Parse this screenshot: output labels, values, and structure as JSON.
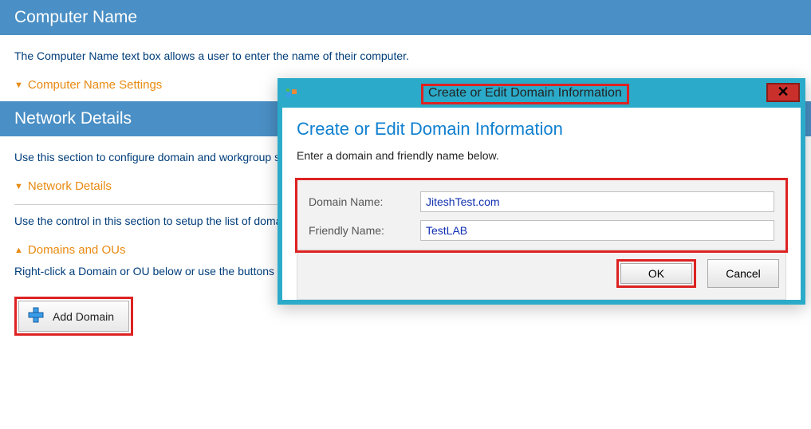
{
  "sections": {
    "computerName": {
      "title": "Computer Name",
      "description": "The Computer Name text box allows a user to enter the name of their computer.",
      "collapsible": "Computer Name Settings"
    },
    "networkDetails": {
      "title": "Network Details",
      "description": "Use this section to configure domain and workgroup settings.",
      "collapsible1": "Network Details",
      "midText": "Use the control in this section to setup the list of domains displayed to the user in the domain drop down list on this wizard page.",
      "collapsible2": "Domains and OUs",
      "belowText": "Right-click a Domain or OU below or use the buttons in the ribbon to add, remove, or edit the domains and OUs that will be displayed in the wizard.",
      "addDomainLabel": "Add Domain"
    }
  },
  "dialog": {
    "titlebar": "Create or Edit Domain Information",
    "heading": "Create or Edit Domain Information",
    "subtitle": "Enter a domain and friendly name below.",
    "domainLabel": "Domain Name:",
    "domainValue": "JiteshTest.com",
    "friendlyLabel": "Friendly Name:",
    "friendlyValue": "TestLAB",
    "okLabel": "OK",
    "cancelLabel": "Cancel"
  }
}
